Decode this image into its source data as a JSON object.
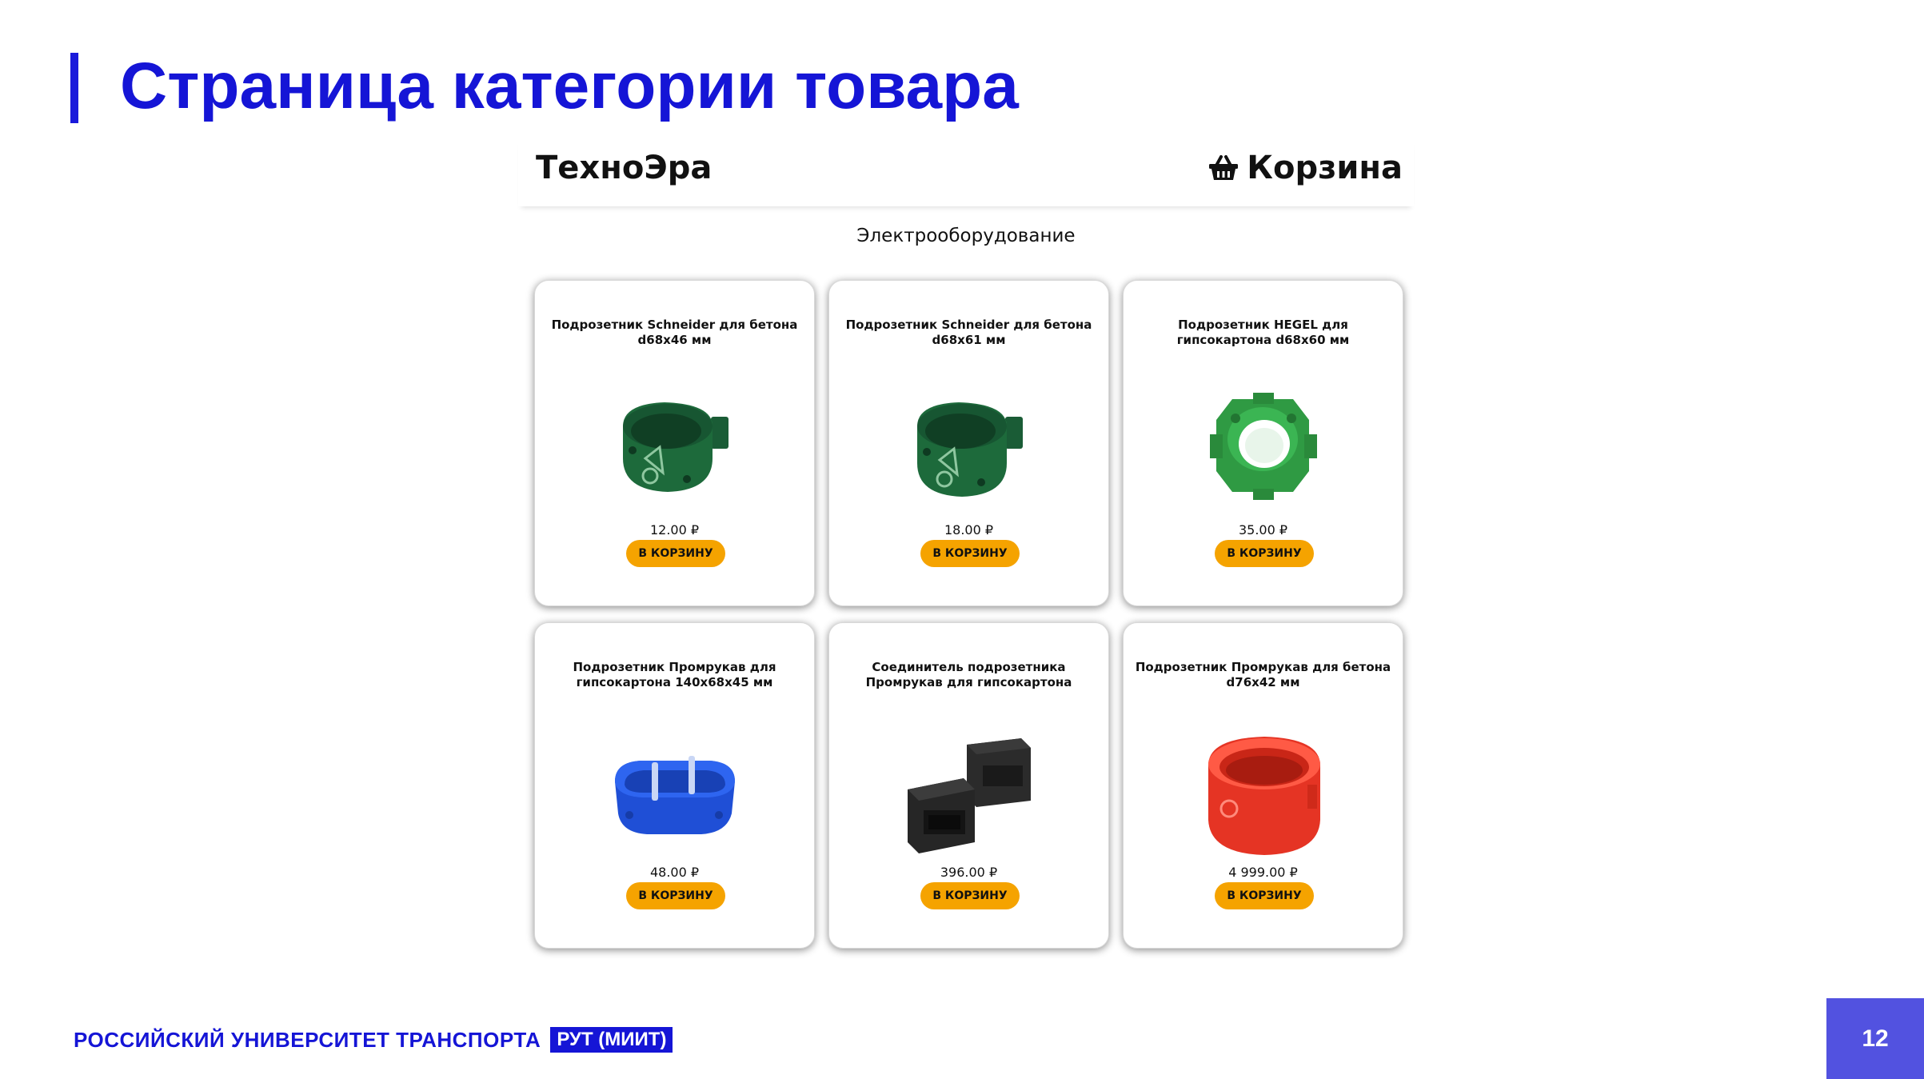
{
  "slide": {
    "title": "Страница категории товара",
    "footer_university": "РОССИЙСКИЙ УНИВЕРСИТЕТ ТРАНСПОРТА",
    "footer_badge": "РУТ (МИИТ)",
    "page_number": "12"
  },
  "shop": {
    "brand": "ТехноЭра",
    "cart_label": "Корзина",
    "cart_icon": "basket-icon",
    "category": "Электрооборудование",
    "button_color": "#f5a300",
    "products": [
      {
        "title": "Подрозетник Schneider для бетона d68x46 мм",
        "price": "12.00 ₽",
        "button": "В КОРЗИНУ",
        "image": "dark-green-round-box"
      },
      {
        "title": "Подрозетник Schneider для бетона d68x61 мм",
        "price": "18.00 ₽",
        "button": "В КОРЗИНУ",
        "image": "dark-green-round-box"
      },
      {
        "title": "Подрозетник HEGEL для гипсокартона d68x60 мм",
        "price": "35.00 ₽",
        "button": "В КОРЗИНУ",
        "image": "green-round-box"
      },
      {
        "title": "Подрозетник Промрукав для гипсокартона 140x68x45 мм",
        "price": "48.00 ₽",
        "button": "В КОРЗИНУ",
        "image": "blue-double-box"
      },
      {
        "title": "Соединитель подрозетника Промрукав для гипсокартона",
        "price": "396.00 ₽",
        "button": "В КОРЗИНУ",
        "image": "black-connectors"
      },
      {
        "title": "Подрозетник Промрукав для бетона d76x42 мм",
        "price": "4 999.00 ₽",
        "button": "В КОРЗИНУ",
        "image": "red-round-box"
      }
    ]
  }
}
